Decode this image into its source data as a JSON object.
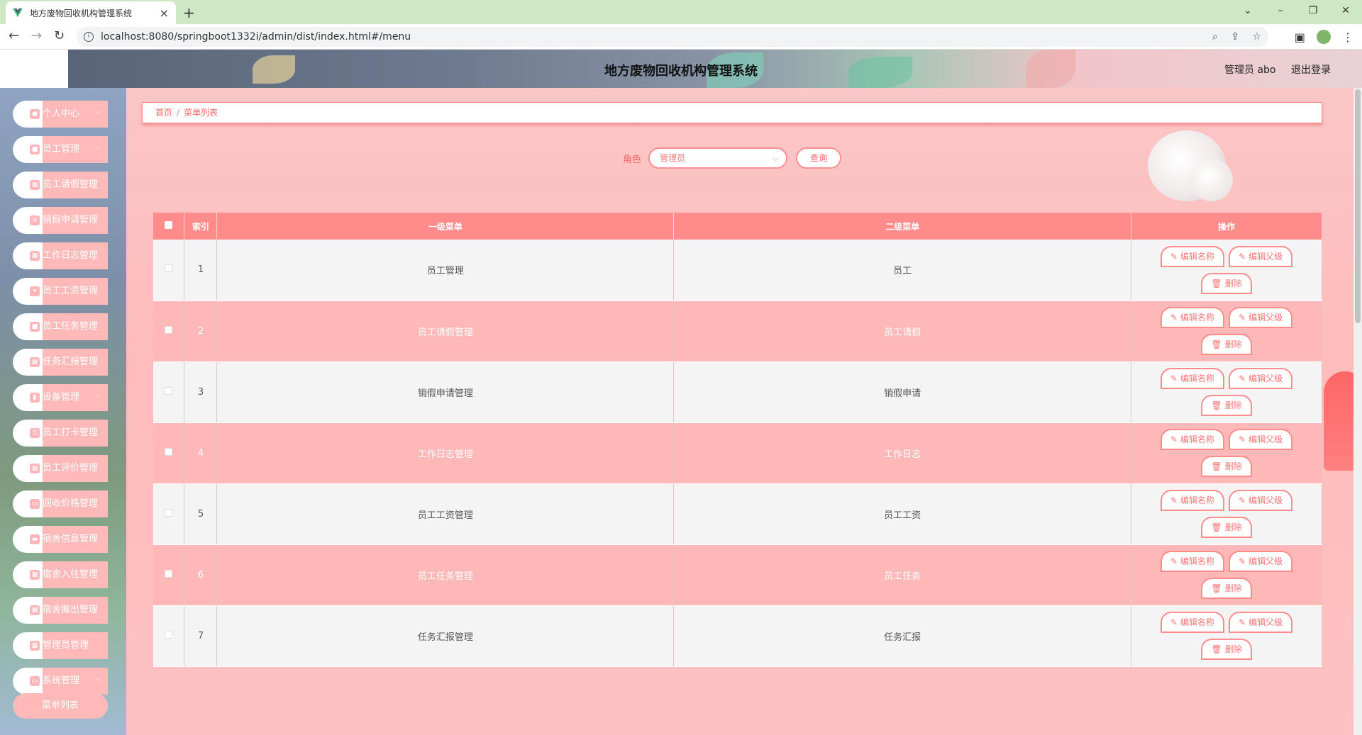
{
  "browser": {
    "tab_title": "地方废物回收机构管理系统",
    "url": "localhost:8080/springboot1332i/admin/dist/index.html#/menu"
  },
  "header": {
    "title": "地方废物回收机构管理系统",
    "admin_label": "管理员 abo",
    "logout_label": "退出登录"
  },
  "sidebar": {
    "items": [
      {
        "label": "个人中心",
        "icon": "user-icon",
        "chevron": "⌵"
      },
      {
        "label": "员工管理",
        "icon": "lock-icon",
        "chevron": "⌵"
      },
      {
        "label": "员工请假管理",
        "icon": "grid-icon"
      },
      {
        "label": "销假申请管理",
        "icon": "sliders-icon"
      },
      {
        "label": "工作日志管理",
        "icon": "grid-icon"
      },
      {
        "label": "员工工资管理",
        "icon": "pin-icon"
      },
      {
        "label": "员工任务管理",
        "icon": "lock-icon"
      },
      {
        "label": "任务汇报管理",
        "icon": "grid-icon"
      },
      {
        "label": "设备管理",
        "icon": "chart-icon",
        "chevron": "⌵"
      },
      {
        "label": "员工打卡管理",
        "icon": "list-icon"
      },
      {
        "label": "员工评价管理",
        "icon": "grid-icon"
      },
      {
        "label": "回收价格管理",
        "icon": "monitor-icon"
      },
      {
        "label": "宿舍信息管理",
        "icon": "ticket-icon"
      },
      {
        "label": "宿舍入住管理",
        "icon": "grid-icon"
      },
      {
        "label": "宿舍搬出管理",
        "icon": "grid-icon"
      },
      {
        "label": "管理员管理",
        "icon": "grid-icon"
      },
      {
        "label": "系统管理",
        "icon": "monitor-icon",
        "chevron": "⌵"
      }
    ],
    "sub_item": "菜单列表"
  },
  "breadcrumb": {
    "home": "首页",
    "sep": "/",
    "current": "菜单列表"
  },
  "filter": {
    "label": "角色",
    "value": "管理员",
    "query_button": "查询"
  },
  "table": {
    "headers": {
      "index": "索引",
      "menu1": "一级菜单",
      "menu2": "二级菜单",
      "ops": "操作"
    },
    "op_labels": {
      "edit_name": "编辑名称",
      "edit_parent": "编辑父级",
      "delete": "删除"
    },
    "rows": [
      {
        "index": "1",
        "menu1": "员工管理",
        "menu2": "员工"
      },
      {
        "index": "2",
        "menu1": "员工请假管理",
        "menu2": "员工请假"
      },
      {
        "index": "3",
        "menu1": "销假申请管理",
        "menu2": "销假申请"
      },
      {
        "index": "4",
        "menu1": "工作日志管理",
        "menu2": "工作日志"
      },
      {
        "index": "5",
        "menu1": "员工工资管理",
        "menu2": "员工工资"
      },
      {
        "index": "6",
        "menu1": "员工任务管理",
        "menu2": "员工任务"
      },
      {
        "index": "7",
        "menu1": "任务汇报管理",
        "menu2": "任务汇报"
      }
    ]
  },
  "colors": {
    "accent": "#ff8b8b",
    "row_pink": "#ffb8b8",
    "row_grey": "#f4f4f4"
  }
}
